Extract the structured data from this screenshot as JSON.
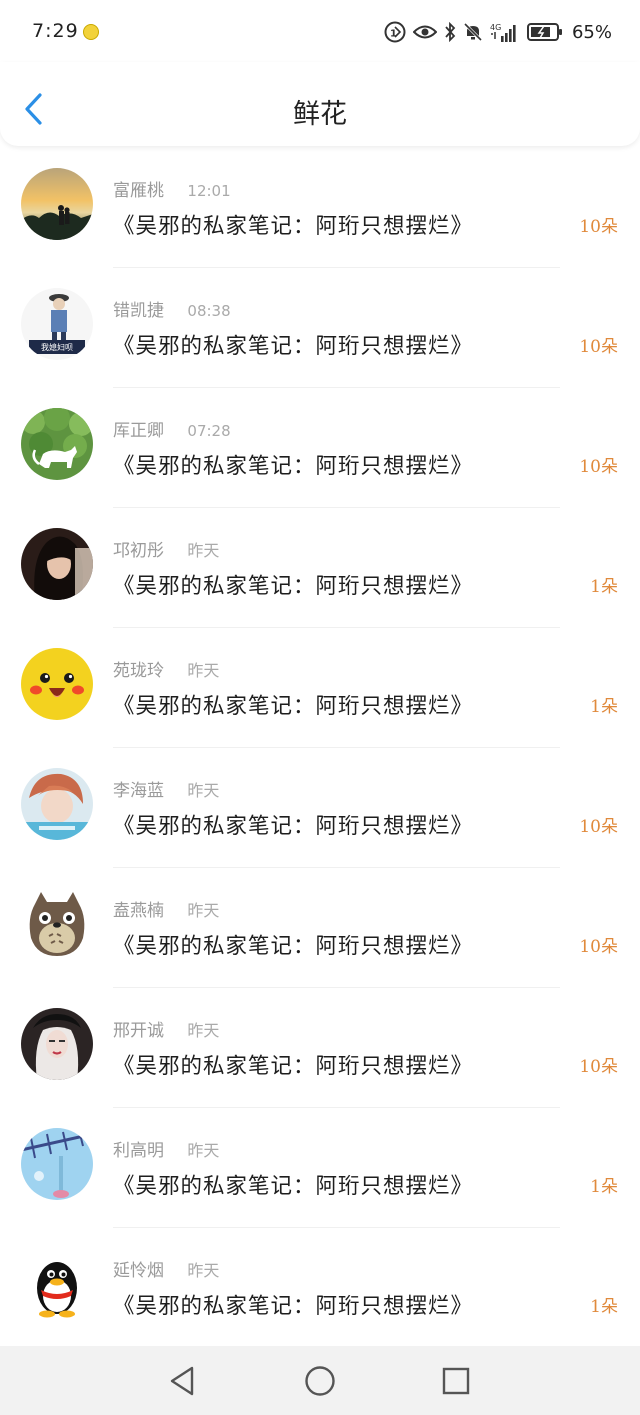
{
  "status_bar": {
    "time": "7:29",
    "battery_percent": "65%",
    "network_label": "4G"
  },
  "header": {
    "title": "鲜花",
    "back_icon": "chevron-left-icon",
    "accent_color": "#2b8fe6"
  },
  "flowers": {
    "count_color": "#e08a3c",
    "items": [
      {
        "name": "富雁桃",
        "time": "12:01",
        "book": "《吴邪的私家笔记：阿珩只想摆烂》",
        "count": "10朵"
      },
      {
        "name": "错凯捷",
        "time": "08:38",
        "book": "《吴邪的私家笔记：阿珩只想摆烂》",
        "count": "10朵",
        "avatar_caption": "我媳妇呗"
      },
      {
        "name": "厍正卿",
        "time": "07:28",
        "book": "《吴邪的私家笔记：阿珩只想摆烂》",
        "count": "10朵"
      },
      {
        "name": "邛初彤",
        "time": "昨天",
        "book": "《吴邪的私家笔记：阿珩只想摆烂》",
        "count": "1朵"
      },
      {
        "name": "苑珑玲",
        "time": "昨天",
        "book": "《吴邪的私家笔记：阿珩只想摆烂》",
        "count": "1朵"
      },
      {
        "name": "李海蓝",
        "time": "昨天",
        "book": "《吴邪的私家笔记：阿珩只想摆烂》",
        "count": "10朵"
      },
      {
        "name": "盍燕楠",
        "time": "昨天",
        "book": "《吴邪的私家笔记：阿珩只想摆烂》",
        "count": "10朵"
      },
      {
        "name": "邢开诚",
        "time": "昨天",
        "book": "《吴邪的私家笔记：阿珩只想摆烂》",
        "count": "10朵"
      },
      {
        "name": "利高明",
        "time": "昨天",
        "book": "《吴邪的私家笔记：阿珩只想摆烂》",
        "count": "1朵"
      },
      {
        "name": "延怜烟",
        "time": "昨天",
        "book": "《吴邪的私家笔记：阿珩只想摆烂》",
        "count": "1朵"
      }
    ]
  },
  "nav_bar": {
    "back_icon": "triangle-back-icon",
    "home_icon": "circle-home-icon",
    "recents_icon": "square-recents-icon"
  }
}
